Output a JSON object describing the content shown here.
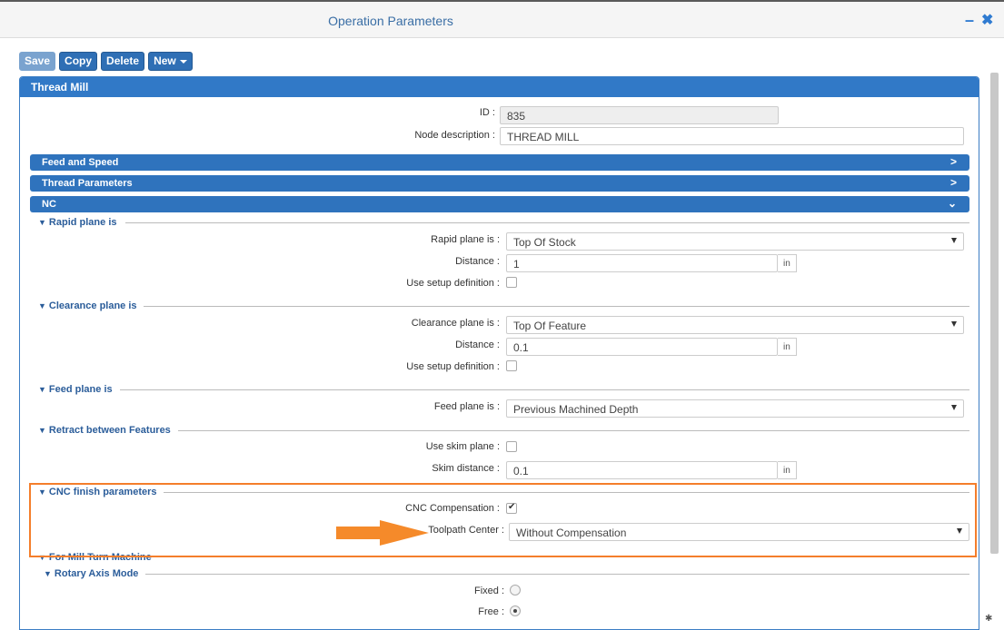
{
  "window": {
    "title": "Operation Parameters",
    "minimize_icon": "minus-icon",
    "close_icon": "close-icon"
  },
  "toolbar": {
    "save": "Save",
    "copy": "Copy",
    "delete": "Delete",
    "new": "New"
  },
  "panel": {
    "title": "Thread Mill"
  },
  "fields": {
    "id_label": "ID :",
    "id_value": "835",
    "node_desc_label": "Node description :",
    "node_desc_value": "THREAD MILL"
  },
  "bars": {
    "feed_speed": "Feed and Speed",
    "thread_params": "Thread Parameters",
    "nc": "NC"
  },
  "rapid": {
    "section": "Rapid plane is",
    "plane_label": "Rapid plane is :",
    "plane_value": "Top Of Stock",
    "distance_label": "Distance :",
    "distance_value": "1",
    "unit": "in",
    "setup_label": "Use setup definition :"
  },
  "clearance": {
    "section": "Clearance plane is",
    "plane_label": "Clearance plane is :",
    "plane_value": "Top Of Feature",
    "distance_label": "Distance :",
    "distance_value": "0.1",
    "unit": "in",
    "setup_label": "Use setup definition :"
  },
  "feed": {
    "section": "Feed plane is",
    "plane_label": "Feed plane is :",
    "plane_value": "Previous Machined Depth"
  },
  "retract": {
    "section": "Retract between Features",
    "skim_plane_label": "Use skim plane :",
    "skim_distance_label": "Skim distance :",
    "skim_distance_value": "0.1",
    "unit": "in"
  },
  "cnc": {
    "section": "CNC finish parameters",
    "compensation_label": "CNC Compensation :",
    "compensation_checked": true,
    "toolpath_label": "Toolpath Center :",
    "toolpath_value": "Without Compensation"
  },
  "mill_turn": {
    "section": "For Mill Turn Machine"
  },
  "rotary": {
    "section": "Rotary Axis Mode",
    "fixed_label": "Fixed :",
    "free_label": "Free :",
    "selected": "Free"
  },
  "colors": {
    "accent": "#3179c7",
    "highlight": "#f47e2b"
  }
}
